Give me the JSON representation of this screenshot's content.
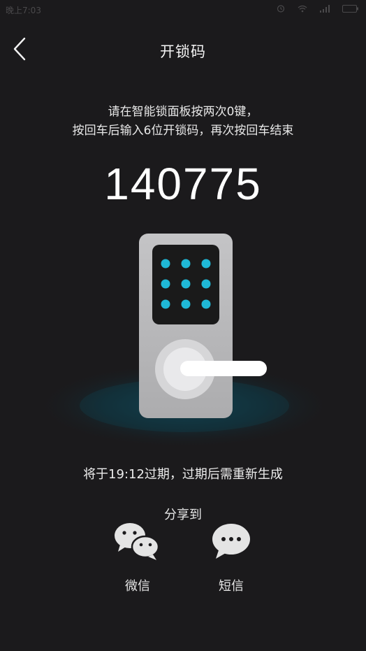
{
  "status_bar": {
    "time": "晚上7:03"
  },
  "nav": {
    "title": "开锁码"
  },
  "instructions": {
    "line1": "请在智能锁面板按两次0键，",
    "line2": "按回车后输入6位开锁码，再次按回车结束"
  },
  "code": "140775",
  "expiry": "将于19:12过期，过期后需重新生成",
  "share": {
    "label": "分享到",
    "options": [
      {
        "label": "微信",
        "icon": "wechat-icon"
      },
      {
        "label": "短信",
        "icon": "sms-icon"
      }
    ]
  },
  "colors": {
    "background": "#1b1a1c",
    "keypad_dot": "#1fb8d6",
    "lock_body": "#b9b9bb",
    "glow": "#0e5e74"
  }
}
